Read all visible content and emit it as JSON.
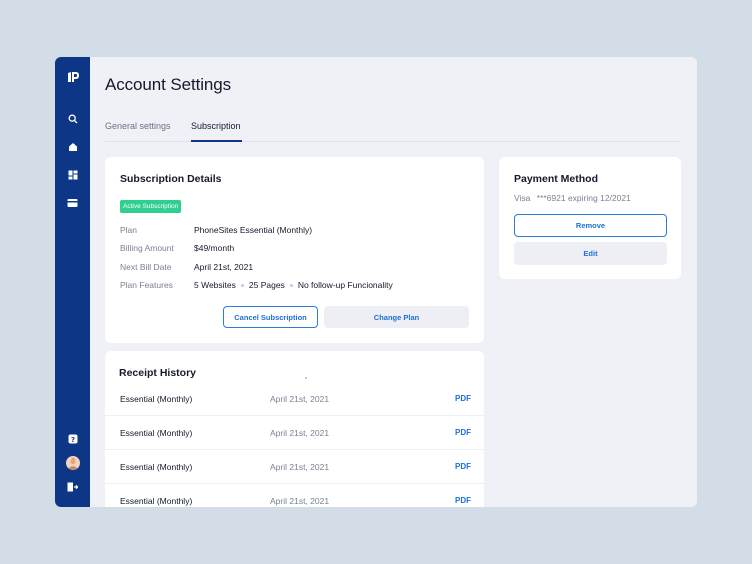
{
  "page": {
    "title": "Account Settings"
  },
  "sidebar": {
    "icons": [
      "logo-icon",
      "search-icon",
      "home-icon",
      "dashboard-icon",
      "billing-icon",
      "help-icon",
      "avatar",
      "logout-icon"
    ]
  },
  "tabs": [
    {
      "label": "General settings",
      "active": false
    },
    {
      "label": "Subscription",
      "active": true
    }
  ],
  "subscription": {
    "title": "Subscription Details",
    "status_badge": "Active Subscription",
    "plan_label": "Plan",
    "plan_value": "PhoneSites Essential (Monthly)",
    "billing_label": "Billing Amount",
    "billing_value": "$49/month",
    "next_bill_label": "Next Bill Date",
    "next_bill_value": "April 21st, 2021",
    "features_label": "Plan Features",
    "features": [
      "5 Websites",
      "25 Pages",
      "No follow-up Funcionality"
    ],
    "cancel_label": "Cancel Subscription",
    "change_label": "Change Plan"
  },
  "payment": {
    "title": "Payment Method",
    "brand": "Visa",
    "details": "***6921 expiring 12/2021",
    "remove_label": "Remove",
    "edit_label": "Edit"
  },
  "receipts": {
    "title": "Receipt History",
    "rows": [
      {
        "name": "Essential (Monthly)",
        "date": "April 21st, 2021",
        "link": "PDF"
      },
      {
        "name": "Essential (Monthly)",
        "date": "April 21st, 2021",
        "link": "PDF"
      },
      {
        "name": "Essential (Monthly)",
        "date": "April 21st, 2021",
        "link": "PDF"
      },
      {
        "name": "Essential (Monthly)",
        "date": "April 21st, 2021",
        "link": "PDF"
      }
    ]
  },
  "colors": {
    "sidebar": "#0e3687",
    "accent": "#1f6fd6",
    "badge": "#2ecf8f",
    "background": "#d3dde8"
  }
}
